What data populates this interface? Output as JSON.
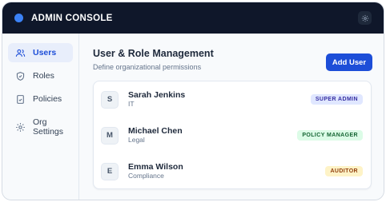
{
  "app": {
    "title": "ADMIN CONSOLE",
    "accent": "#3b82f6",
    "titlebar_bg": "#0f172a",
    "settings_icon": "gear-icon"
  },
  "sidebar": {
    "items": [
      {
        "label": "Users",
        "icon": "users-icon",
        "active": true
      },
      {
        "label": "Roles",
        "icon": "shield-icon",
        "active": false
      },
      {
        "label": "Policies",
        "icon": "document-check-icon",
        "active": false
      },
      {
        "label": "Org Settings",
        "icon": "gear-icon",
        "active": false
      }
    ]
  },
  "main": {
    "title": "User & Role Management",
    "subtitle": "Define organizational permissions",
    "add_button": "Add User",
    "users": [
      {
        "initial": "S",
        "name": "Sarah Jenkins",
        "department": "IT",
        "role": "SUPER ADMIN",
        "badge_bg": "#e0e7ff",
        "badge_fg": "#3730a3"
      },
      {
        "initial": "M",
        "name": "Michael Chen",
        "department": "Legal",
        "role": "POLICY MANAGER",
        "badge_bg": "#dcfce7",
        "badge_fg": "#166534"
      },
      {
        "initial": "E",
        "name": "Emma Wilson",
        "department": "Compliance",
        "role": "AUDITOR",
        "badge_bg": "#fef3c7",
        "badge_fg": "#92400e"
      }
    ]
  }
}
